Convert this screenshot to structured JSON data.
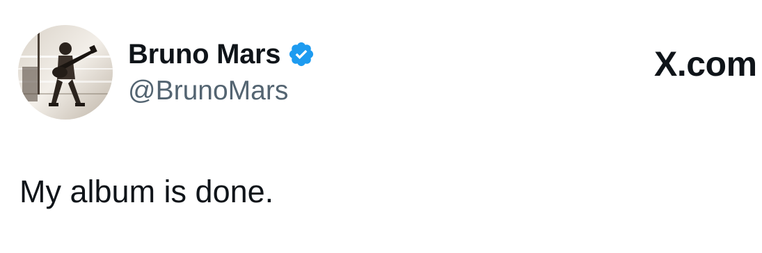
{
  "tweet": {
    "display_name": "Bruno Mars",
    "handle": "@BrunoMars",
    "text": "My album is done.",
    "verified_icon": "verified-badge-icon",
    "avatar_icon": "avatar-photo"
  },
  "branding": {
    "label": "X.com"
  },
  "colors": {
    "text_primary": "#0f1419",
    "text_secondary": "#536471",
    "verified_blue": "#1d9bf0",
    "background": "#ffffff"
  }
}
